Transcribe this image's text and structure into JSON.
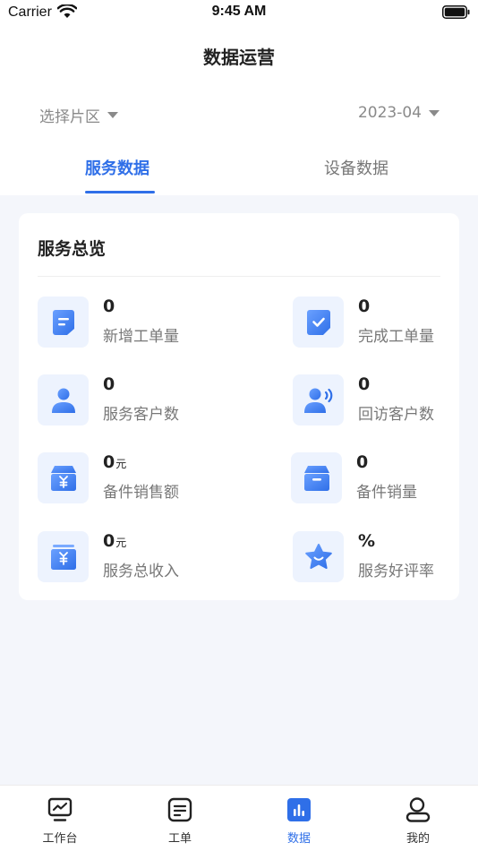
{
  "status_bar": {
    "carrier": "Carrier",
    "time": "9:45 AM"
  },
  "header": {
    "title": "数据运营"
  },
  "filters": {
    "region": "选择片区",
    "date": "2023-04"
  },
  "tabs": [
    {
      "label": "服务数据",
      "active": true
    },
    {
      "label": "设备数据",
      "active": false
    }
  ],
  "overview": {
    "title": "服务总览",
    "stats": [
      {
        "value": "0",
        "unit": "",
        "label": "新增工单量",
        "icon": "new-order-icon"
      },
      {
        "value": "0",
        "unit": "",
        "label": "完成工单量",
        "icon": "completed-order-icon"
      },
      {
        "value": "0",
        "unit": "",
        "label": "服务客户数",
        "icon": "customer-icon"
      },
      {
        "value": "0",
        "unit": "",
        "label": "回访客户数",
        "icon": "return-visit-icon"
      },
      {
        "value": "0",
        "unit": "元",
        "label": "备件销售额",
        "icon": "parts-sales-amount-icon"
      },
      {
        "value": "0",
        "unit": "",
        "label": "备件销量",
        "icon": "parts-sales-volume-icon"
      },
      {
        "value": "0",
        "unit": "元",
        "label": "服务总收入",
        "icon": "service-income-icon"
      },
      {
        "value": "%",
        "unit": "",
        "label": "服务好评率",
        "icon": "star-rating-icon"
      }
    ]
  },
  "tabbar": [
    {
      "label": "工作台",
      "icon": "workbench-icon",
      "active": false
    },
    {
      "label": "工单",
      "icon": "work-order-icon",
      "active": false
    },
    {
      "label": "数据",
      "icon": "data-chart-icon",
      "active": true
    },
    {
      "label": "我的",
      "icon": "profile-icon",
      "active": false
    }
  ],
  "colors": {
    "accent": "#2f6fe8",
    "icon_bg": "#edf3fe",
    "page_bg": "#f4f6fb"
  }
}
